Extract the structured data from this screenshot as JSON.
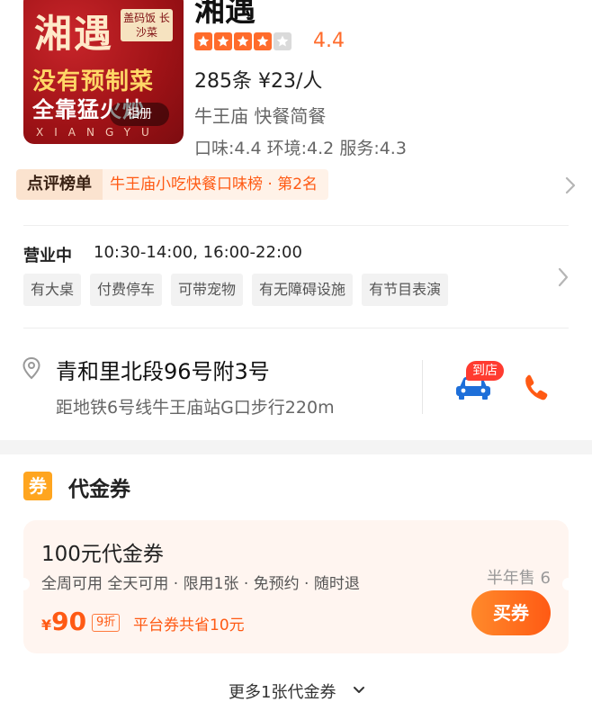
{
  "store": {
    "image": {
      "big_text": "湘遇",
      "tag_text": "盖码饭 长沙菜",
      "slogan_1": "没有预制菜",
      "slogan_2": "全靠猛火炒",
      "brand_latin": "XIANGYU",
      "album_label": "相册"
    },
    "name": "湘遇",
    "rating": "4.4",
    "stars_filled": 4,
    "stars_total": 5,
    "reviews_price": "285条  ¥23/人",
    "location_category": "牛王庙   快餐简餐",
    "scores": "口味:4.4 环境:4.2 服务:4.3"
  },
  "ranking": {
    "label": "点评榜单",
    "text": "牛王庙小吃快餐口味榜 · 第2名"
  },
  "business": {
    "status": "营业中",
    "hours": "10:30-14:00, 16:00-22:00",
    "tags": [
      "有大桌",
      "付费停车",
      "可带宠物",
      "有无障碍设施",
      "有节目表演"
    ]
  },
  "address": {
    "street": "青和里北段96号附3号",
    "distance": "距地铁6号线牛王庙站G口步行220m",
    "arrive_badge": "到店"
  },
  "voucher_section": {
    "icon_text": "券",
    "title": "代金券",
    "card": {
      "title": "100元代金券",
      "rules": "全周可用  全天可用 · 限用1张 · 免预约 · 随时退",
      "sold": "半年售 6",
      "currency": "¥",
      "price": "90",
      "discount": "9折",
      "save_text": "平台券共省10元",
      "buy_label": "买券"
    },
    "more_label": "更多1张代金券"
  },
  "colors": {
    "accent": "#ff5a14",
    "star": "#ff6b2b",
    "coupon_icon": "#ffa51f",
    "card_bg": "#fff5f0"
  },
  "icons": [
    "star-icon",
    "chevron-right-icon",
    "location-pin-icon",
    "car-icon",
    "phone-icon",
    "chevron-down-icon"
  ]
}
